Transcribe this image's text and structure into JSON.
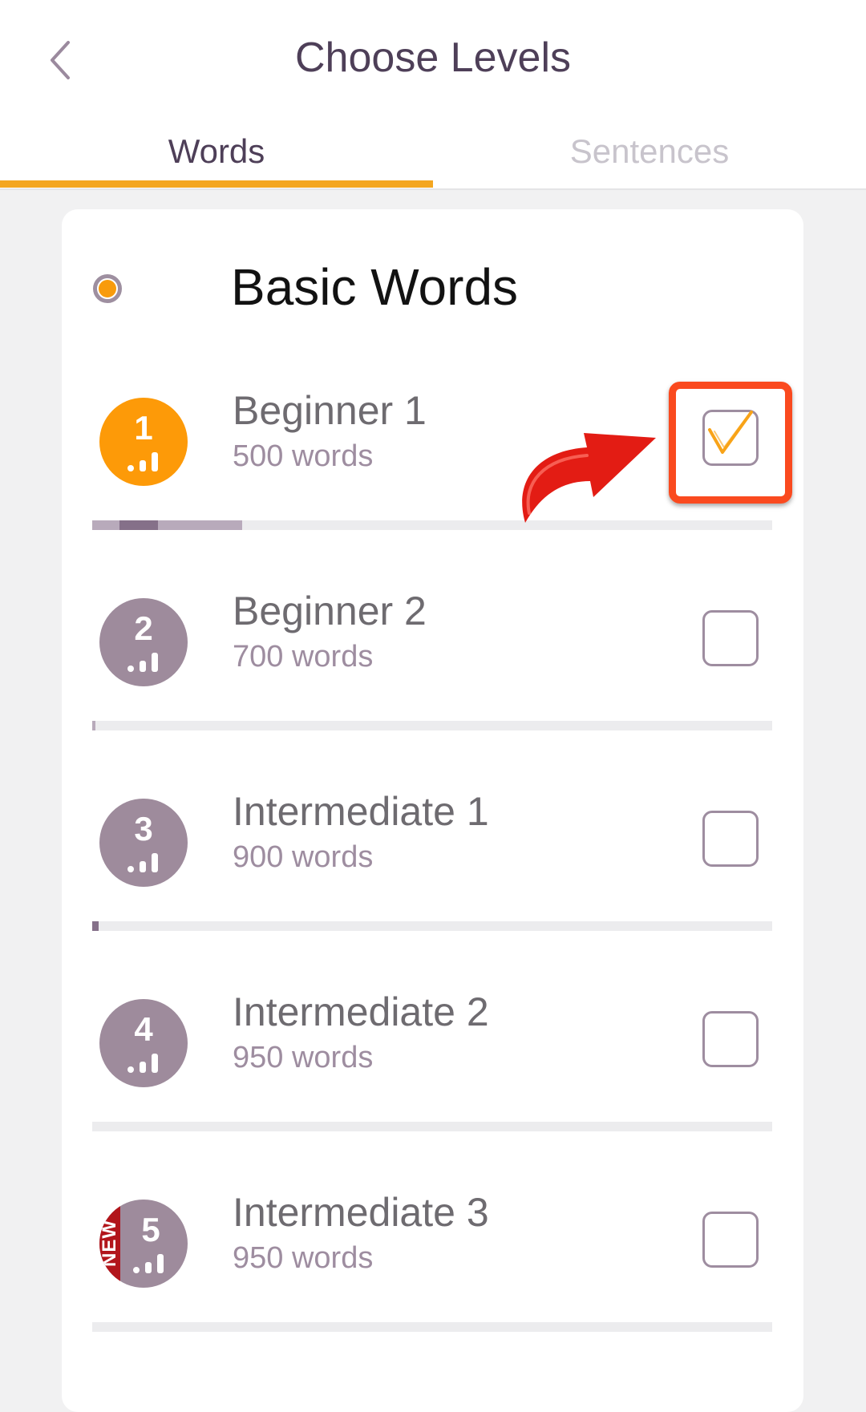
{
  "header": {
    "title": "Choose Levels",
    "back_icon": "chevron-left-icon"
  },
  "tabs": [
    {
      "label": "Words",
      "active": true
    },
    {
      "label": "Sentences",
      "active": false
    }
  ],
  "section": {
    "title": "Basic Words",
    "selected": true
  },
  "levels": [
    {
      "number": "1",
      "name": "Beginner 1",
      "count": "500 words",
      "checked": true,
      "progress": 0.22
    },
    {
      "number": "2",
      "name": "Beginner 2",
      "count": "700 words",
      "checked": false,
      "progress": 0.0
    },
    {
      "number": "3",
      "name": "Intermediate 1",
      "count": "900 words",
      "checked": false,
      "progress": 0.01
    },
    {
      "number": "4",
      "name": "Intermediate 2",
      "count": "950 words",
      "checked": false,
      "progress": 0.0
    },
    {
      "number": "5",
      "name": "Intermediate 3",
      "count": "950 words",
      "checked": false,
      "progress": 0.0,
      "badge_ribbon": "NEW"
    }
  ],
  "colors": {
    "accent": "#f4a620",
    "active_badge": "#fd9a08",
    "inactive_badge": "#9e8b9c",
    "highlight": "#fa4a1f",
    "arrow": "#e31c14"
  }
}
